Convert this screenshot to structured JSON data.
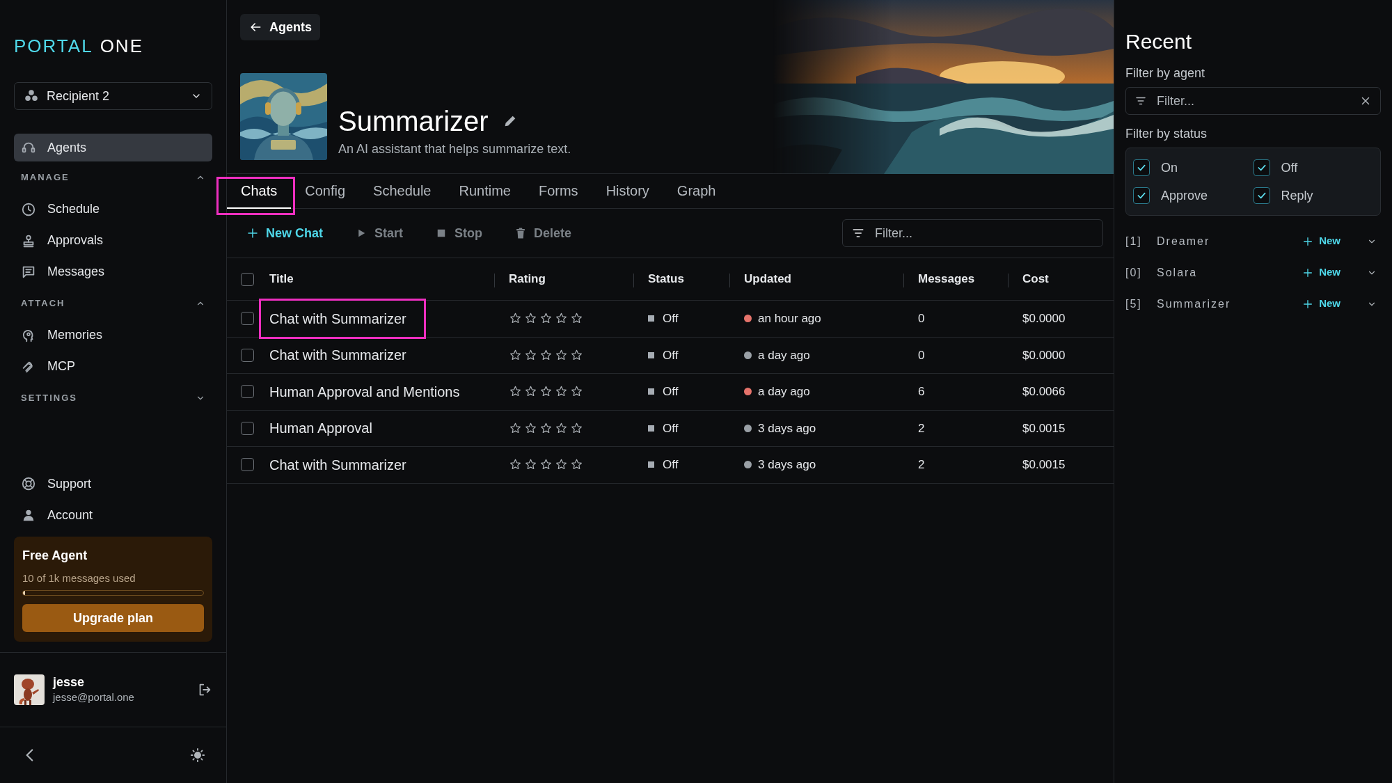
{
  "sidebar": {
    "logo_first": "PORTAL",
    "logo_second": "ONE",
    "workspace": "Recipient 2",
    "top_item": {
      "label": "Agents",
      "selected": true
    },
    "sections": [
      {
        "title": "MANAGE",
        "expanded": true,
        "items": [
          {
            "label": "Schedule",
            "selected": false
          },
          {
            "label": "Approvals",
            "selected": false
          },
          {
            "label": "Messages",
            "selected": false
          }
        ]
      },
      {
        "title": "ATTACH",
        "expanded": true,
        "items": [
          {
            "label": "Memories",
            "selected": false
          },
          {
            "label": "MCP",
            "selected": false
          }
        ]
      },
      {
        "title": "SETTINGS",
        "expanded": false
      }
    ],
    "bottom_items": [
      {
        "label": "Support",
        "selected": false
      },
      {
        "label": "Account",
        "selected": false
      }
    ],
    "plan": {
      "title": "Free Agent",
      "usage": "10 of 1k messages used",
      "level": 0.01,
      "button": "Upgrade plan"
    },
    "user": {
      "name": "jesse",
      "email": "jesse@portal.one"
    }
  },
  "header": {
    "back_button": "Agents",
    "title": "Summarizer",
    "description": "An AI assistant that helps summarize text."
  },
  "tabs": [
    {
      "label": "Chats",
      "selected": true,
      "highlighted": true
    },
    {
      "label": "Config",
      "selected": false,
      "highlighted": false
    },
    {
      "label": "Schedule",
      "selected": false,
      "highlighted": false
    },
    {
      "label": "Runtime",
      "selected": false,
      "highlighted": false
    },
    {
      "label": "Forms",
      "selected": false,
      "highlighted": false
    },
    {
      "label": "History",
      "selected": false,
      "highlighted": false
    },
    {
      "label": "Graph",
      "selected": false,
      "highlighted": false
    }
  ],
  "toolbar": {
    "actions": [
      {
        "label": "New Chat",
        "disabled": false
      },
      {
        "label": "Start",
        "disabled": true
      },
      {
        "label": "Stop",
        "disabled": true
      },
      {
        "label": "Delete",
        "disabled": true
      }
    ],
    "filter_placeholder": "Filter..."
  },
  "table": {
    "columns": [
      "Title",
      "Rating",
      "Status",
      "Updated",
      "Messages",
      "Cost"
    ],
    "all_selected": false,
    "rows": [
      {
        "selected": false,
        "title": "Chat with Summarizer",
        "highlighted": true,
        "stars": 0,
        "status": "Off",
        "updated": "an hour ago",
        "color": "#e5736b",
        "messages": "0",
        "cost": "$0.0000"
      },
      {
        "selected": false,
        "title": "Chat with Summarizer",
        "highlighted": false,
        "stars": 0,
        "status": "Off",
        "updated": "a day ago",
        "color": "#9aa0a6",
        "messages": "0",
        "cost": "$0.0000"
      },
      {
        "selected": false,
        "title": "Human Approval and Mentions",
        "highlighted": false,
        "stars": 0,
        "status": "Off",
        "updated": "a day ago",
        "color": "#e5736b",
        "messages": "6",
        "cost": "$0.0066"
      },
      {
        "selected": false,
        "title": "Human Approval",
        "highlighted": false,
        "stars": 0,
        "status": "Off",
        "updated": "3 days ago",
        "color": "#9aa0a6",
        "messages": "2",
        "cost": "$0.0015"
      },
      {
        "selected": false,
        "title": "Chat with Summarizer",
        "highlighted": false,
        "stars": 0,
        "status": "Off",
        "updated": "3 days ago",
        "color": "#9aa0a6",
        "messages": "2",
        "cost": "$0.0015"
      }
    ]
  },
  "recent": {
    "title": "Recent",
    "agent_filter_label": "Filter by agent",
    "agent_filter_placeholder": "Filter...",
    "status_filter_label": "Filter by status",
    "statuses": [
      {
        "label": "On",
        "checked": true
      },
      {
        "label": "Off",
        "checked": true
      },
      {
        "label": "Approve",
        "checked": true
      },
      {
        "label": "Reply",
        "checked": true
      }
    ],
    "agents": [
      {
        "count": "[1]",
        "name": "Dreamer",
        "new_label": "New"
      },
      {
        "count": "[0]",
        "name": "Solara",
        "new_label": "New"
      },
      {
        "count": "[5]",
        "name": "Summarizer",
        "new_label": "New"
      }
    ]
  }
}
